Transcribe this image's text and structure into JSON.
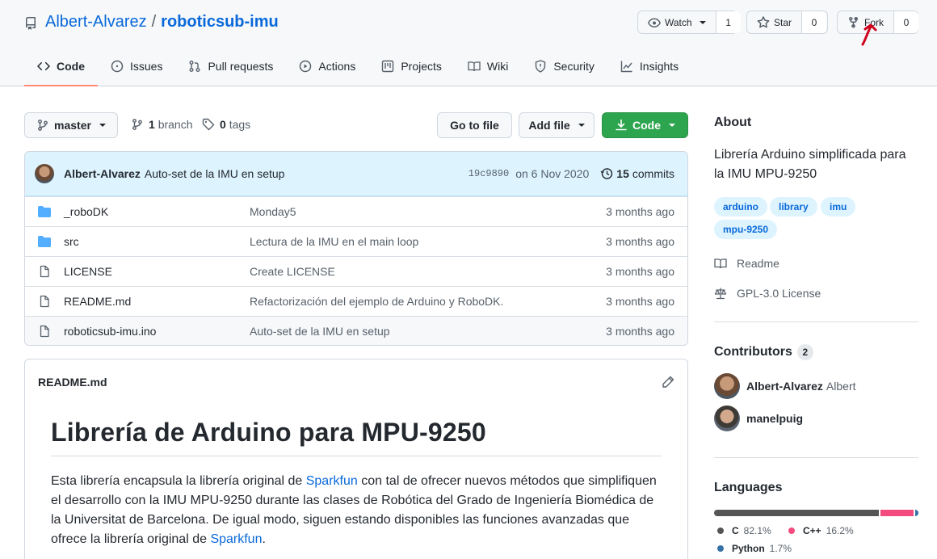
{
  "repo": {
    "owner": "Albert-Alvarez",
    "separator": "/",
    "name": "roboticsub-imu"
  },
  "actions": {
    "watch_label": "Watch",
    "watch_count": "1",
    "star_label": "Star",
    "star_count": "0",
    "fork_label": "Fork",
    "fork_count": "0"
  },
  "tabs": [
    {
      "label": "Code",
      "icon": "code-icon"
    },
    {
      "label": "Issues",
      "icon": "issue-icon"
    },
    {
      "label": "Pull requests",
      "icon": "pull-request-icon"
    },
    {
      "label": "Actions",
      "icon": "play-icon"
    },
    {
      "label": "Projects",
      "icon": "project-icon"
    },
    {
      "label": "Wiki",
      "icon": "book-icon"
    },
    {
      "label": "Security",
      "icon": "shield-icon"
    },
    {
      "label": "Insights",
      "icon": "graph-icon"
    }
  ],
  "toolbar": {
    "branch": "master",
    "branch_count": "1",
    "branch_label": "branch",
    "tag_count": "0",
    "tag_label": "tags",
    "go_to_file": "Go to file",
    "add_file": "Add file",
    "code": "Code"
  },
  "commit": {
    "author": "Albert-Alvarez",
    "message": "Auto-set de la IMU en setup",
    "sha": "19c9890",
    "date": "on 6 Nov 2020",
    "count": "15",
    "count_label": "commits"
  },
  "files": [
    {
      "type": "folder",
      "name": "_roboDK",
      "message": "Monday5",
      "age": "3 months ago"
    },
    {
      "type": "folder",
      "name": "src",
      "message": "Lectura de la IMU en el main loop",
      "age": "3 months ago"
    },
    {
      "type": "file",
      "name": "LICENSE",
      "message": "Create LICENSE",
      "age": "3 months ago"
    },
    {
      "type": "file",
      "name": "README.md",
      "message": "Refactorización del ejemplo de Arduino y RoboDK.",
      "age": "3 months ago"
    },
    {
      "type": "file",
      "name": "roboticsub-imu.ino",
      "message": "Auto-set de la IMU en setup",
      "age": "3 months ago"
    }
  ],
  "readme": {
    "filename": "README.md",
    "heading": "Librería de Arduino para MPU-9250",
    "p_part1": "Esta librería encapsula la librería original de ",
    "link1": "Sparkfun",
    "p_part2": " con tal de ofrecer nuevos métodos que simplifiquen el desarrollo con la IMU MPU-9250 durante las clases de Robótica del Grado de Ingeniería Biomédica de la Universitat de Barcelona. De igual modo, siguen estando disponibles las funciones avanzadas que ofrece la librería original de ",
    "link2": "Sparkfun",
    "p_part3": "."
  },
  "about": {
    "title": "About",
    "description": "Librería Arduino simplificada para la IMU MPU-9250",
    "topics": [
      "arduino",
      "library",
      "imu",
      "mpu-9250"
    ],
    "readme_label": "Readme",
    "license_label": "GPL-3.0 License"
  },
  "contributors": {
    "title": "Contributors",
    "count": "2",
    "people": [
      {
        "login": "Albert-Alvarez",
        "name": "Albert"
      },
      {
        "login": "manelpuig",
        "name": ""
      }
    ]
  },
  "languages": {
    "title": "Languages",
    "items": [
      {
        "name": "C",
        "percent": "82.1%",
        "color": "#555555",
        "value": 82.1
      },
      {
        "name": "C++",
        "percent": "16.2%",
        "color": "#f34b7d",
        "value": 16.2
      },
      {
        "name": "Python",
        "percent": "1.7%",
        "color": "#3572A5",
        "value": 1.7
      }
    ]
  },
  "colors": {
    "accent": "#0969da",
    "green": "#2da44e",
    "annotation": "#d0021b"
  }
}
